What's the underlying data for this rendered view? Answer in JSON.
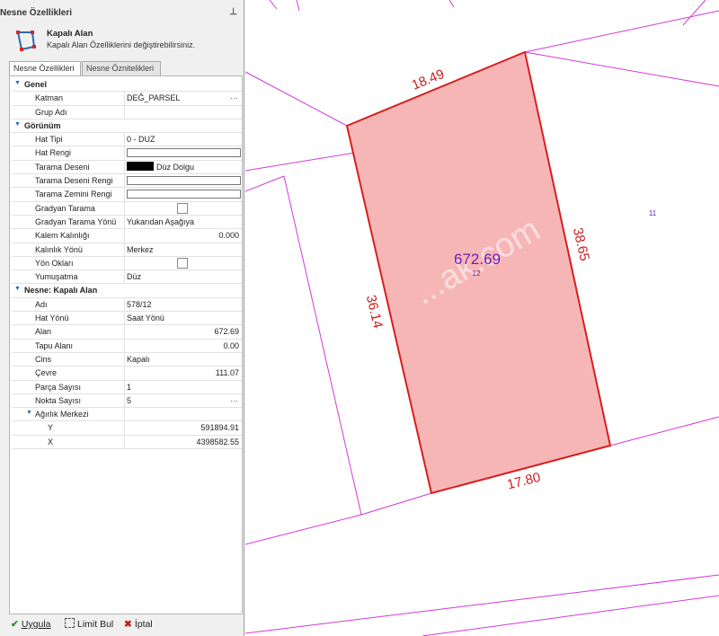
{
  "panel": {
    "title": "Nesne Özellikleri",
    "pin": "📌",
    "summary_title": "Kapalı Alan",
    "summary_desc": "Kapalı Alan Özelliklerini değiştirebilirsiniz.",
    "tabs": [
      "Nesne Özellikleri",
      "Nesne Öznitelikleri"
    ],
    "rows": {
      "genel": "Genel",
      "katman_name": "Katman",
      "katman_val": "DEĞ_PARSEL",
      "grup_name": "Grup Adı",
      "grup_val": "",
      "gorunum": "Görünüm",
      "hattipi_name": "Hat Tipi",
      "hattipi_val": "0 - DUZ",
      "hatrengi_name": "Hat Rengi",
      "taramadeseni_name": "Tarama Deseni",
      "taramadeseni_val": "Düz Dolgu",
      "taramadesenirengi_name": "Tarama Deseni Rengi",
      "taramazemini_name": "Tarama Zemini Rengi",
      "gradyan_name": "Gradyan Tarama",
      "gradyanyonu_name": "Gradyan Tarama Yönü",
      "gradyanyonu_val": "Yukarıdan Aşağıya",
      "kalem_name": "Kalem Kalınlığı",
      "kalem_val": "0.000",
      "kalinlik_name": "Kalınlık Yönü",
      "kalinlik_val": "Merkez",
      "yonoklari_name": "Yön Okları",
      "yumusatma_name": "Yumuşatma",
      "yumusatma_val": "Düz",
      "nesne": "Nesne: Kapalı Alan",
      "adi_name": "Adı",
      "adi_val": "578/12",
      "hatyonu_name": "Hat Yönü",
      "hatyonu_val": "Saat Yönü",
      "alan_name": "Alan",
      "alan_val": "672.69",
      "tapu_name": "Tapu Alanı",
      "tapu_val": "0.00",
      "cins_name": "Cins",
      "cins_val": "Kapalı",
      "cevre_name": "Çevre",
      "cevre_val": "111.07",
      "parca_name": "Parça Sayısı",
      "parca_val": "1",
      "nokta_name": "Nokta Sayısı",
      "nokta_val": "5",
      "agirlik": "Ağırlık Merkezi",
      "y_name": "Y",
      "y_val": "591894.91",
      "x_name": "X",
      "x_val": "4398582.55"
    },
    "footer": {
      "apply": "Uygula",
      "limit": "Limit Bul",
      "cancel": "İptal"
    }
  },
  "map": {
    "area_label": "672.69",
    "parcel_number": "12",
    "neighbor_number": "11",
    "edge_top": "18.49",
    "edge_right": "38.65",
    "edge_left": "36.14",
    "edge_bottom": "17.80",
    "watermark": "...ak.com",
    "colors": {
      "parcel_fill": "#f7b6b6",
      "parcel_stroke": "#d81e1e",
      "lines": "#d23ad6",
      "text": "#c81e1e",
      "area_text": "#6a1fb0"
    }
  }
}
